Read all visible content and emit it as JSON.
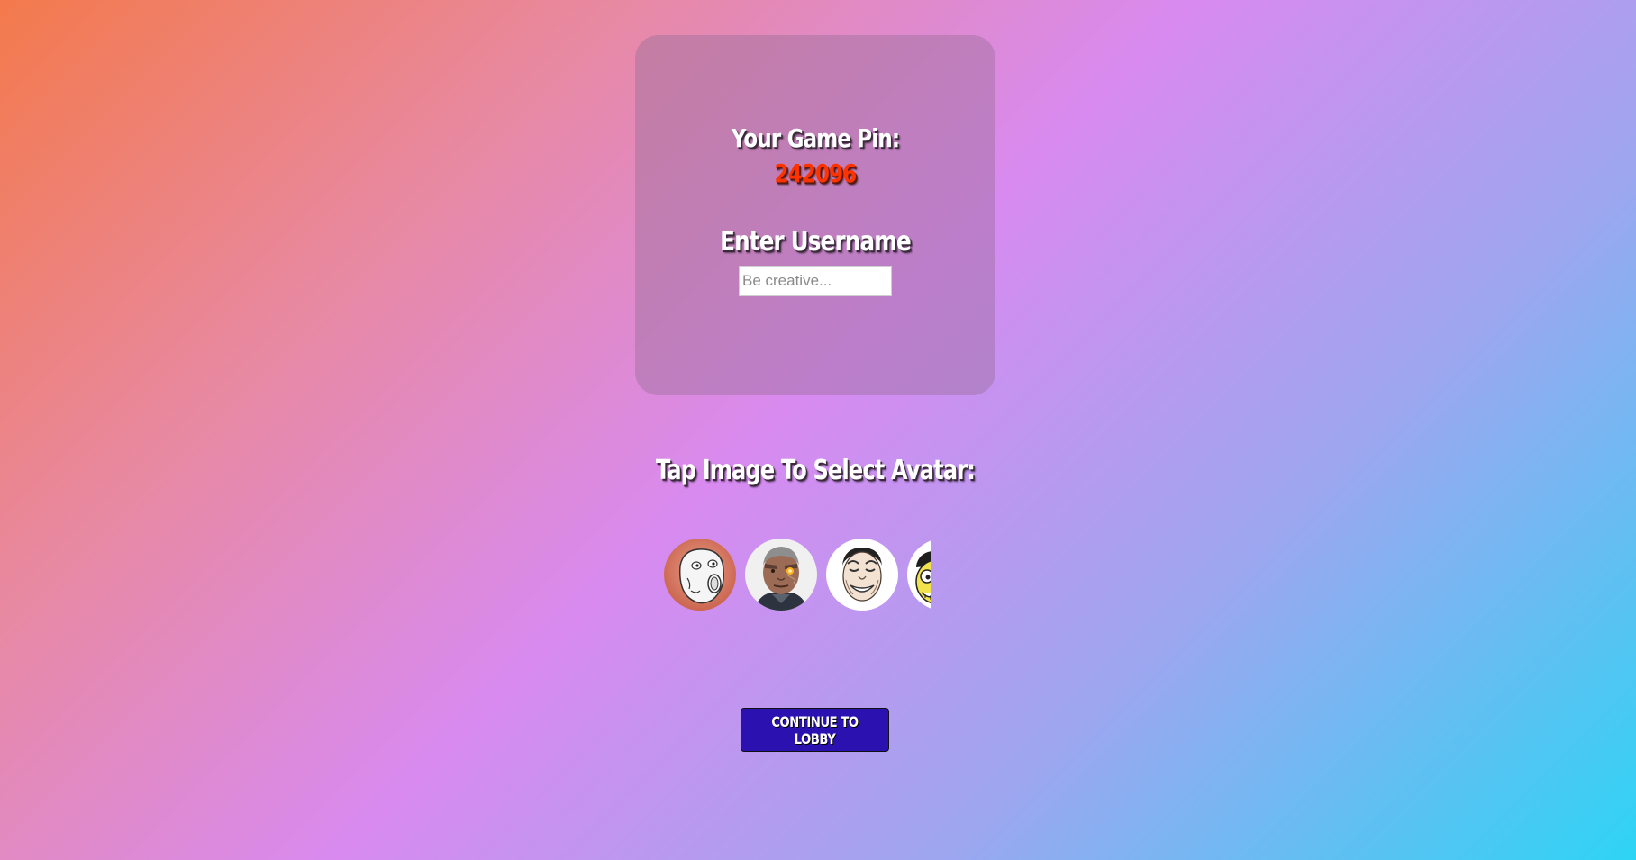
{
  "card": {
    "pin_label": "Your Game Pin:",
    "pin_value": "242096",
    "username_label": "Enter Username",
    "username_placeholder": "Be creative...",
    "username_value": ""
  },
  "avatars": {
    "label": "Tap Image To Select Avatar:",
    "items": [
      {
        "icon": "troll-face-avatar-icon"
      },
      {
        "icon": "cyborg-soldier-avatar-icon"
      },
      {
        "icon": "laughing-man-avatar-icon"
      },
      {
        "icon": "cartoon-character-avatar-icon"
      }
    ]
  },
  "continue_button": {
    "label": "CONTINUE TO LOBBY"
  },
  "colors": {
    "pin_value": "#ff3300",
    "button_bg": "#2a11b0",
    "gradient_start": "#f47a4c",
    "gradient_mid": "#d88af0",
    "gradient_end": "#2ed4f4"
  }
}
